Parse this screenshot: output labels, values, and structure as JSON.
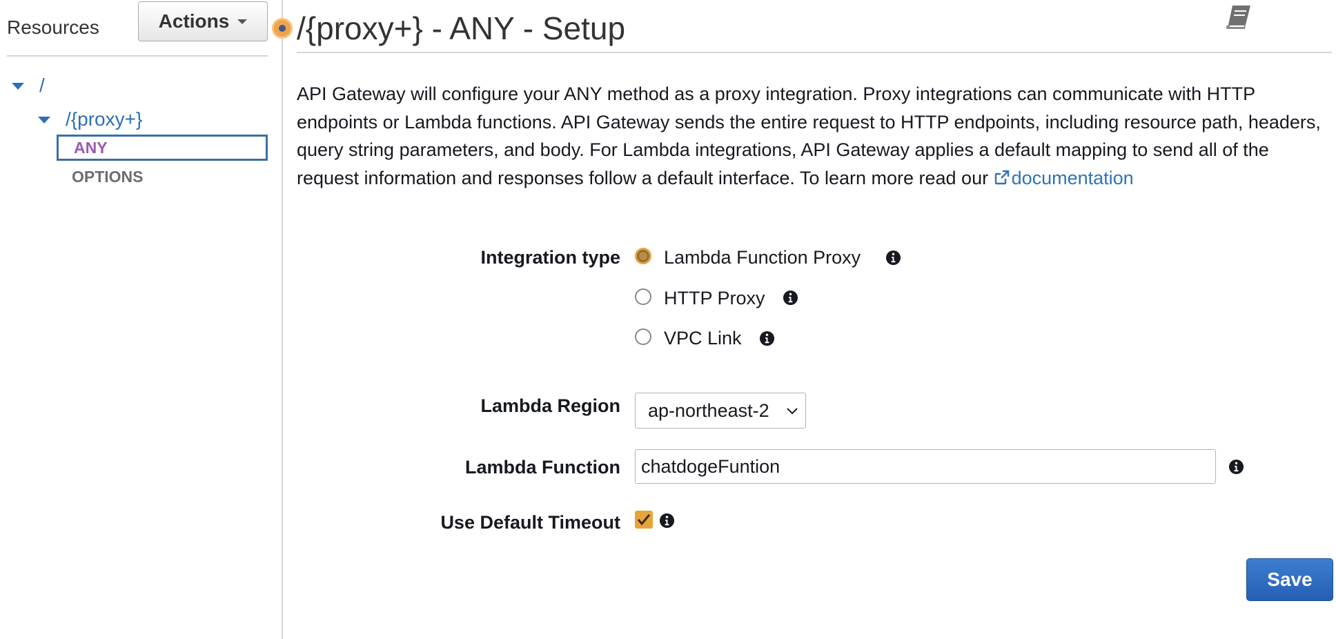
{
  "sidebar": {
    "title": "Resources",
    "actions_label": "Actions",
    "tree": {
      "root": "/",
      "child": "/{proxy+}",
      "methods": [
        "ANY",
        "OPTIONS"
      ]
    }
  },
  "header": {
    "title": "/{proxy+} - ANY - Setup"
  },
  "description": {
    "text": "API Gateway will configure your ANY method as a proxy integration. Proxy integrations can communicate with HTTP endpoints or Lambda functions. API Gateway sends the entire request to HTTP endpoints, including resource path, headers, query string parameters, and body. For Lambda integrations, API Gateway applies a default mapping to send all of the request information and responses follow a default interface. To learn more read our ",
    "link_label": "documentation"
  },
  "form": {
    "integration_type_label": "Integration type",
    "integration_options": [
      {
        "label": "Lambda Function Proxy",
        "selected": true
      },
      {
        "label": "HTTP Proxy",
        "selected": false
      },
      {
        "label": "VPC Link",
        "selected": false
      }
    ],
    "lambda_region_label": "Lambda Region",
    "lambda_region_value": "ap-northeast-2",
    "lambda_function_label": "Lambda Function",
    "lambda_function_value": "chatdogeFuntion",
    "default_timeout_label": "Use Default Timeout",
    "default_timeout_checked": true,
    "save_label": "Save"
  },
  "icons": {
    "info": "info-icon",
    "book": "book-icon",
    "external_link": "external-link-icon"
  },
  "colors": {
    "accent_orange": "#e8a33a",
    "link_blue": "#2e73b8",
    "method_purple": "#9b59b6",
    "save_blue": "#245fb4"
  }
}
